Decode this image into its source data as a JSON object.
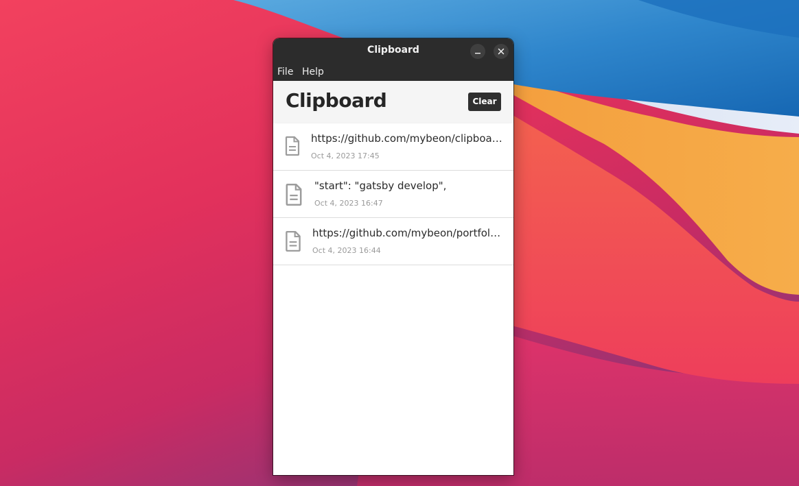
{
  "window": {
    "title": "Clipboard"
  },
  "titlebar_buttons": {
    "minimize_icon": "minimize-icon",
    "close_icon": "close-icon"
  },
  "menu": {
    "file": "File",
    "help": "Help"
  },
  "header": {
    "title": "Clipboard",
    "clear_label": "Clear"
  },
  "items": [
    {
      "text": "https://github.com/mybeon/clipboard-app",
      "time": "Oct 4, 2023 17:45",
      "icon": "document-icon"
    },
    {
      "text": "\"start\": \"gatsby develop\",",
      "time": "Oct 4, 2023 16:47",
      "icon": "document-icon"
    },
    {
      "text": "https://github.com/mybeon/portfolio-website",
      "time": "Oct 4, 2023 16:44",
      "icon": "document-icon"
    }
  ],
  "colors": {
    "titlebar": "#2c2c2c",
    "header_bg": "#f5f5f5",
    "button_bg": "#2f2f2f",
    "icon_gray": "#9c9c9c"
  }
}
